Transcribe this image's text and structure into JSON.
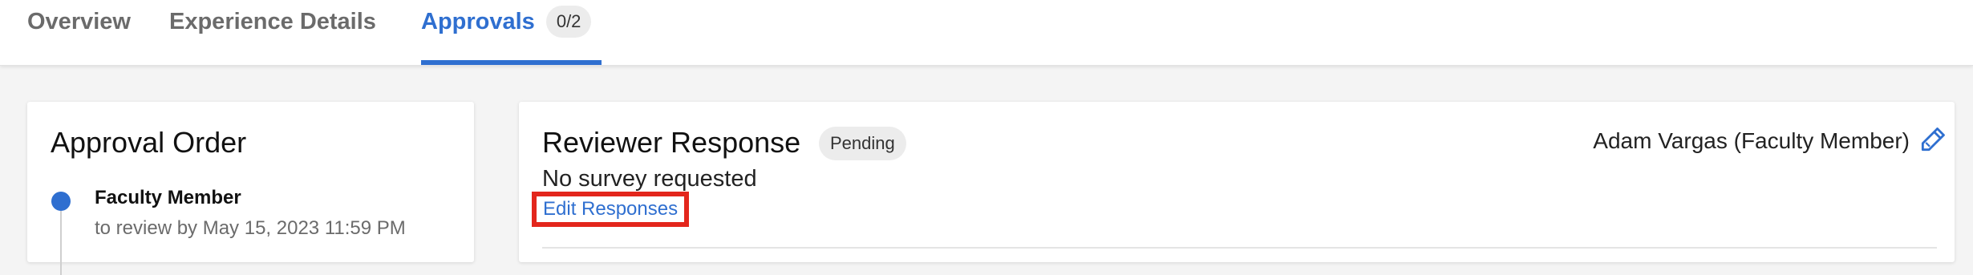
{
  "tabs": {
    "overview": "Overview",
    "experience_details": "Experience Details",
    "approvals": "Approvals",
    "approvals_count": "0/2",
    "active_color": "#2f6fd0"
  },
  "approval_order": {
    "title": "Approval Order",
    "steps": [
      {
        "role": "Faculty Member",
        "due": "to review by May 15, 2023 11:59 PM"
      }
    ]
  },
  "reviewer_response": {
    "title": "Reviewer Response",
    "status": "Pending",
    "reviewer": "Adam Vargas (Faculty Member)",
    "edit_icon": "pencil-icon",
    "survey_text": "No survey requested",
    "edit_link": "Edit Responses",
    "highlight_color": "#e3261c"
  }
}
